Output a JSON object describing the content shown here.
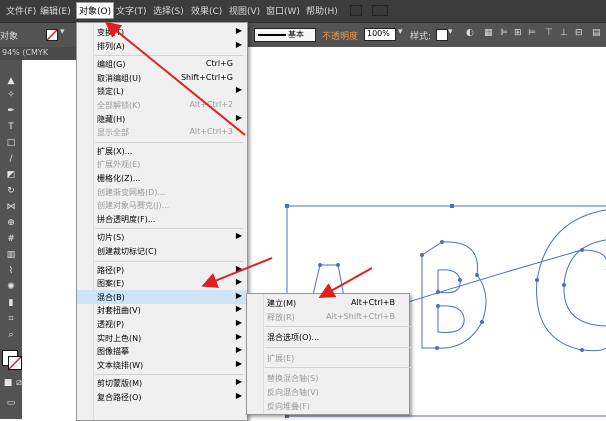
{
  "menubar": {
    "items": [
      "文件(F)",
      "编辑(E)",
      "对象(O)",
      "文字(T)",
      "选择(S)",
      "效果(C)",
      "视图(V)",
      "窗口(W)",
      "帮助(H)"
    ],
    "active_index": 2
  },
  "control": {
    "label_left": "对象",
    "stroke_style": "基本",
    "opacity_label": "不透明度",
    "opacity_value": "100%",
    "style_label": "样式:"
  },
  "tab": {
    "title": "94% (CMYK"
  },
  "object_menu": {
    "items": [
      {
        "label": "变换(T)",
        "shortcut": "",
        "submenu": true,
        "disabled": false
      },
      {
        "label": "排列(A)",
        "shortcut": "",
        "submenu": true,
        "disabled": false
      },
      {
        "sep": true
      },
      {
        "label": "编组(G)",
        "shortcut": "Ctrl+G",
        "submenu": false,
        "disabled": false
      },
      {
        "label": "取消编组(U)",
        "shortcut": "Shift+Ctrl+G",
        "submenu": false,
        "disabled": false
      },
      {
        "label": "锁定(L)",
        "shortcut": "",
        "submenu": true,
        "disabled": false
      },
      {
        "label": "全部解锁(K)",
        "shortcut": "Alt+Ctrl+2",
        "submenu": false,
        "disabled": true
      },
      {
        "label": "隐藏(H)",
        "shortcut": "",
        "submenu": true,
        "disabled": false
      },
      {
        "label": "显示全部",
        "shortcut": "Alt+Ctrl+3",
        "submenu": false,
        "disabled": true
      },
      {
        "sep": true
      },
      {
        "label": "扩展(X)...",
        "shortcut": "",
        "submenu": false,
        "disabled": false
      },
      {
        "label": "扩展外观(E)",
        "shortcut": "",
        "submenu": false,
        "disabled": true
      },
      {
        "label": "栅格化(Z)...",
        "shortcut": "",
        "submenu": false,
        "disabled": false
      },
      {
        "label": "创建渐变网格(D)...",
        "shortcut": "",
        "submenu": false,
        "disabled": true
      },
      {
        "label": "创建对象马赛克(J)...",
        "shortcut": "",
        "submenu": false,
        "disabled": true
      },
      {
        "label": "拼合透明度(F)...",
        "shortcut": "",
        "submenu": false,
        "disabled": false
      },
      {
        "sep": true
      },
      {
        "label": "切片(S)",
        "shortcut": "",
        "submenu": true,
        "disabled": false
      },
      {
        "label": "创建裁切标记(C)",
        "shortcut": "",
        "submenu": false,
        "disabled": false
      },
      {
        "sep": true
      },
      {
        "label": "路径(P)",
        "shortcut": "",
        "submenu": true,
        "disabled": false
      },
      {
        "label": "图案(E)",
        "shortcut": "",
        "submenu": true,
        "disabled": false
      },
      {
        "label": "混合(B)",
        "shortcut": "",
        "submenu": true,
        "disabled": false,
        "highlighted": true
      },
      {
        "label": "封套扭曲(V)",
        "shortcut": "",
        "submenu": true,
        "disabled": false
      },
      {
        "label": "透视(P)",
        "shortcut": "",
        "submenu": true,
        "disabled": false
      },
      {
        "label": "实时上色(N)",
        "shortcut": "",
        "submenu": true,
        "disabled": false
      },
      {
        "label": "图像描摹",
        "shortcut": "",
        "submenu": true,
        "disabled": false
      },
      {
        "label": "文本绕排(W)",
        "shortcut": "",
        "submenu": true,
        "disabled": false
      },
      {
        "sep": true
      },
      {
        "label": "剪切蒙版(M)",
        "shortcut": "",
        "submenu": true,
        "disabled": false
      },
      {
        "label": "复合路径(O)",
        "shortcut": "",
        "submenu": true,
        "disabled": false
      }
    ]
  },
  "blend_submenu": {
    "items": [
      {
        "label": "建立(M)",
        "shortcut": "Alt+Ctrl+B",
        "disabled": false
      },
      {
        "label": "释放(R)",
        "shortcut": "Alt+Shift+Ctrl+B",
        "disabled": true
      },
      {
        "sep": true
      },
      {
        "label": "混合选项(O)...",
        "shortcut": "",
        "disabled": false
      },
      {
        "sep": true
      },
      {
        "label": "扩展(E)",
        "shortcut": "",
        "disabled": true
      },
      {
        "sep": true
      },
      {
        "label": "替换混合轴(S)",
        "shortcut": "",
        "disabled": true
      },
      {
        "label": "反向混合轴(V)",
        "shortcut": "",
        "disabled": true
      },
      {
        "label": "反向堆叠(F)",
        "shortcut": "",
        "disabled": true
      }
    ]
  },
  "colors": {
    "menubar": "#3c3c3c",
    "panel": "#535353",
    "menu_bg": "#f0f0f0",
    "highlight": "#cde4f7",
    "path": "#4a6fc9",
    "arrow": "#e02020"
  }
}
